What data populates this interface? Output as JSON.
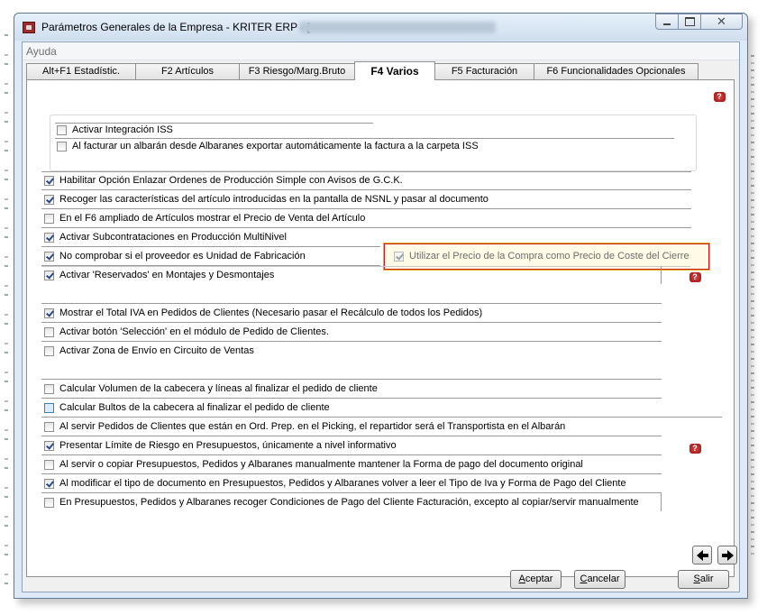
{
  "window": {
    "title": "Parámetros Generales de la Empresa - KRITER ERP - [",
    "controls": {
      "minimize": "minimize-icon",
      "maximize": "maximize-icon",
      "close": "close-icon"
    }
  },
  "menu": {
    "ayuda": "Ayuda"
  },
  "tabs": [
    {
      "label": "Alt+F1 Estadístic."
    },
    {
      "label": "F2 Artículos"
    },
    {
      "label": "F3 Riesgo/Marg.Bruto"
    },
    {
      "label": "F4 Varios",
      "active": true
    },
    {
      "label": "F5 Facturación"
    },
    {
      "label": "F6 Funcionalidades Opcionales"
    }
  ],
  "iss": {
    "items": [
      {
        "label": "Activar Integración ISS",
        "checked": false
      },
      {
        "label": "Al facturar un albarán desde Albaranes exportar automáticamente la factura a la carpeta ISS",
        "checked": false
      }
    ]
  },
  "production": {
    "items": [
      {
        "label": "Habilitar Opción Enlazar Ordenes de Producción Simple con Avisos de G.C.K.",
        "checked": true
      },
      {
        "label": "Recoger las características del artículo introducidas en la pantalla de NSNL y pasar al documento",
        "checked": true
      },
      {
        "label": "En el F6 ampliado de Artículos mostrar el Precio de Venta del Artículo",
        "checked": false
      },
      {
        "label": "Activar Subcontrataciones en Producción MultiNivel",
        "checked": true
      },
      {
        "label": "No comprobar si el proveedor es Unidad de Fabricación",
        "checked": true
      },
      {
        "label": "Activar 'Reservados' en Montajes y Desmontajes",
        "checked": true
      }
    ],
    "highlighted": {
      "label": "Utilizar el Precio de la Compra como Precio de Coste del Cierre",
      "checked": true,
      "disabled": true
    }
  },
  "orders": {
    "items": [
      {
        "label": "Mostrar el Total IVA en Pedidos de Clientes (Necesario pasar el Recálculo de todos los Pedidos)",
        "checked": true
      },
      {
        "label": "Activar botón 'Selección' en el módulo de Pedido de Clientes.",
        "checked": false
      },
      {
        "label": "Activar Zona de Envío en Circuito de Ventas",
        "checked": false
      }
    ]
  },
  "sales": {
    "items": [
      {
        "label": "Calcular Volumen de la cabecera y líneas al finalizar el pedido de cliente",
        "checked": false
      },
      {
        "label": "Calcular Bultos de la cabecera al finalizar el pedido de cliente",
        "checked": false
      },
      {
        "label": "Al servir Pedidos de Clientes que están en Ord. Prep. en el Picking, el repartidor será el Transportista en el Albarán",
        "checked": false
      },
      {
        "label": "Presentar Límite de Riesgo en Presupuestos, únicamente a nivel informativo",
        "checked": true
      },
      {
        "label": "Al servir o copiar Presupuestos, Pedidos y Albaranes manualmente mantener la Forma de pago del documento original",
        "checked": false
      },
      {
        "label": "Al modificar el tipo de documento en Presupuestos, Pedidos y Albaranes volver a leer el Tipo de Iva y Forma de Pago del Cliente",
        "checked": true
      },
      {
        "label": "En Presupuestos, Pedidos y Albaranes recoger Condiciones de Pago del Cliente Facturación, excepto al copiar/servir manualmente",
        "checked": false
      }
    ]
  },
  "help": {
    "glyph": "?"
  },
  "buttons": {
    "aceptar_first": "A",
    "aceptar_rest": "ceptar",
    "cancelar_first": "C",
    "cancelar_rest": "ancelar",
    "salir_first": "S",
    "salir_rest": "alir"
  },
  "colors": {
    "accent": "#d21b1b",
    "highlight_border": "#e0b020",
    "check": "#2b4a8c"
  }
}
